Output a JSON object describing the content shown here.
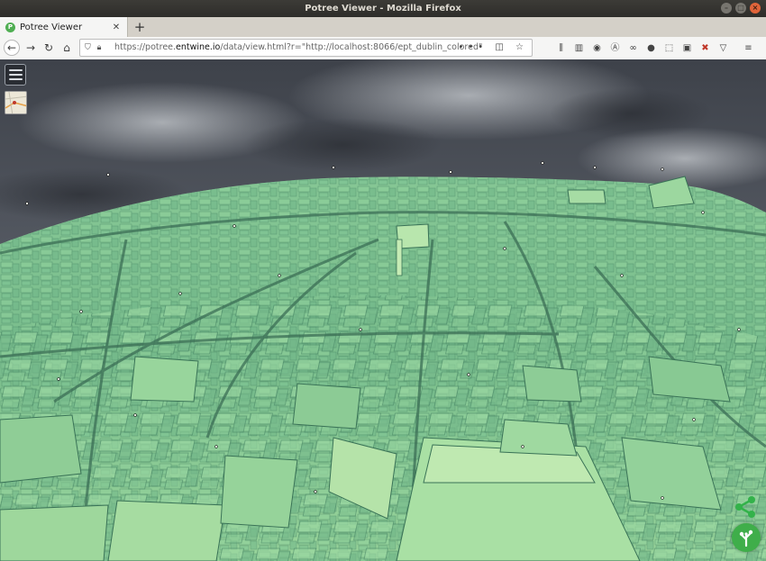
{
  "window": {
    "title": "Potree Viewer - Mozilla Firefox",
    "controls": [
      "minimize-icon",
      "maximize-icon",
      "close-icon"
    ]
  },
  "tabs": [
    {
      "label": "Potree Viewer",
      "favicon": "potree-icon",
      "active": true
    }
  ],
  "navigation": {
    "url_prefix": "https://potree.",
    "url_host": "entwine.io",
    "url_rest": "/data/view.html?r=\"http://localhost:8066/ept_dublin_colored\"",
    "page_actions": "•••",
    "icons": [
      "back-icon",
      "forward-icon",
      "reload-icon",
      "home-icon",
      "shield-icon",
      "lock-icon",
      "pocket-icon",
      "bookmark-star-icon"
    ]
  },
  "toolbar": {
    "icons": [
      "library-icon",
      "sidebar-icon",
      "sync-icon",
      "extension-icon",
      "sunglasses-icon",
      "account-icon",
      "screenshot-icon",
      "image-icon",
      "puzzle-icon",
      "tracking-icon",
      "hamburger-menu-icon"
    ]
  },
  "viewer": {
    "dataset": "ept_dublin_colored",
    "colors": {
      "sky_top": "#4a4e56",
      "sky_bottom": "#9aa0a6",
      "point_cloud_light": "#a8dc9c",
      "point_cloud_mid": "#7ec48f",
      "point_cloud_dark": "#4e9a74",
      "logo": "#3fae4a"
    },
    "overlay_icons": [
      "menu-icon",
      "map-icon",
      "share-icon",
      "potree-logo-icon"
    ]
  }
}
